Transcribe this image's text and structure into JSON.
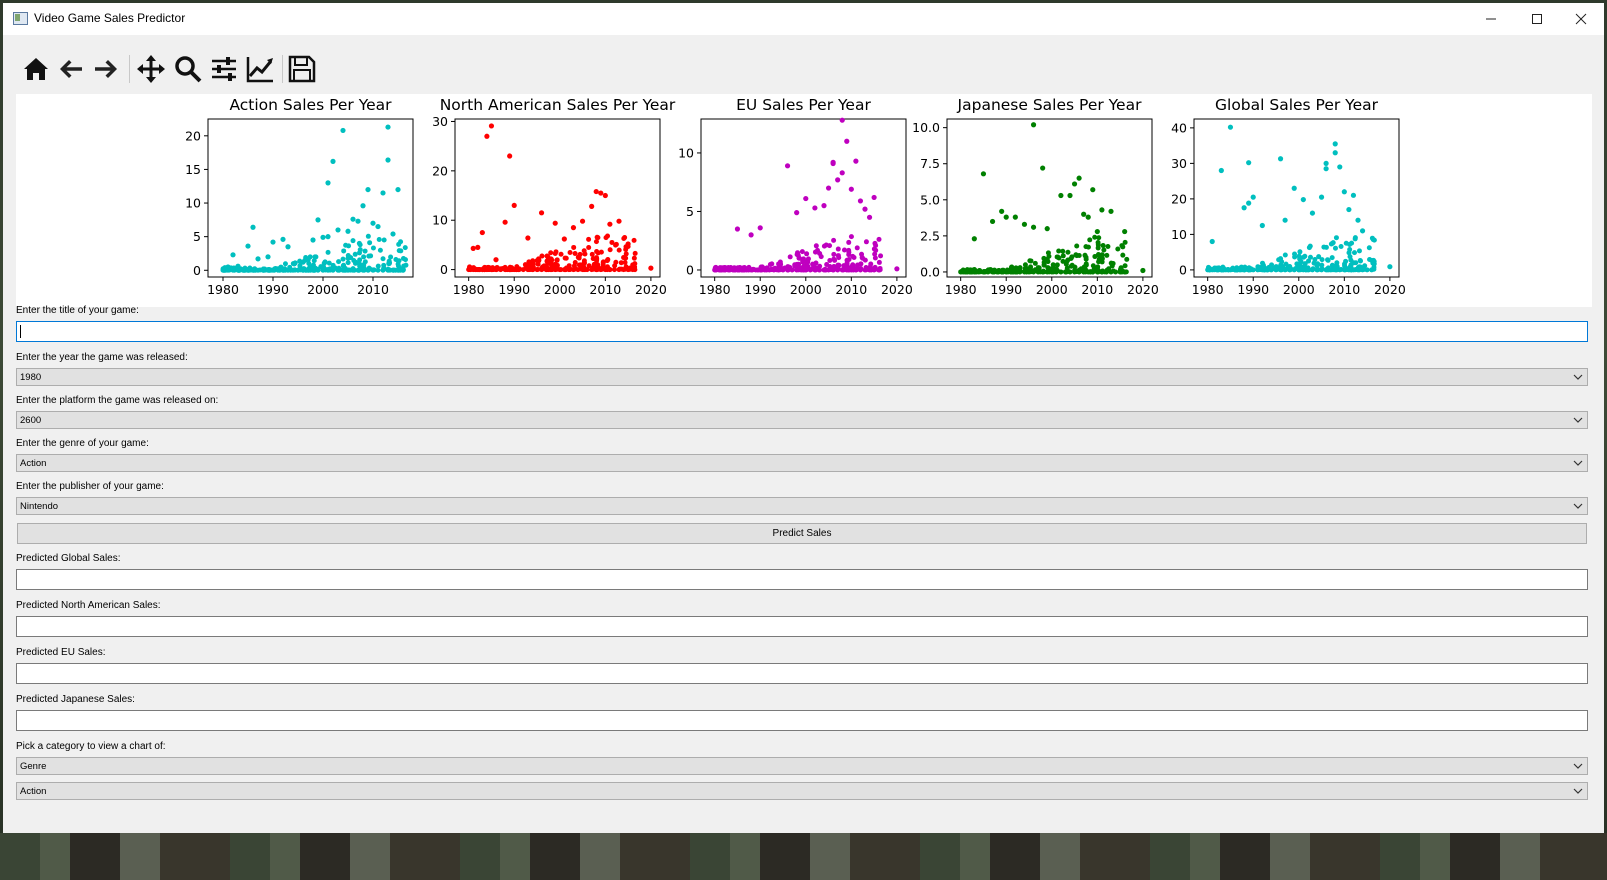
{
  "window": {
    "title": "Video Game Sales Predictor"
  },
  "toolbar": {
    "buttons": [
      "home-icon",
      "back-arrow-icon",
      "forward-arrow-icon",
      "pan-move-icon",
      "zoom-magnifier-icon",
      "configure-subplots-icon",
      "edit-axis-curve-icon",
      "save-floppy-icon"
    ]
  },
  "chart_data": [
    {
      "type": "scatter",
      "title": "Action Sales Per Year",
      "color": "#00bfbf",
      "xlim": [
        1977,
        2018
      ],
      "ylim": [
        -1,
        22.5
      ],
      "xticks": [
        "1980",
        "1990",
        "2000",
        "2010"
      ],
      "yticks": [
        "0",
        "5",
        "10",
        "15",
        "20"
      ],
      "x": [
        1981,
        1982,
        1983,
        1985,
        1986,
        1987,
        1989,
        1990,
        1992,
        1993,
        1996,
        1998,
        1999,
        2000,
        2001,
        2001,
        2002,
        2003,
        2004,
        2005,
        2006,
        2007,
        2008,
        2009,
        2010,
        2011,
        2012,
        2013,
        2013,
        2014,
        2015
      ],
      "y": [
        0.5,
        2.3,
        0.6,
        3.6,
        6.4,
        1.7,
        2.0,
        4.2,
        4.6,
        3.5,
        1.2,
        4.5,
        7.5,
        4.9,
        13.0,
        5.0,
        16.2,
        6.0,
        20.8,
        5.8,
        7.6,
        7.3,
        9.6,
        12.0,
        7.0,
        6.5,
        11.5,
        21.3,
        16.4,
        5.4,
        12.0
      ]
    },
    {
      "type": "scatter",
      "title": "North American Sales Per Year",
      "color": "#ff0000",
      "xlim": [
        1977,
        2022
      ],
      "ylim": [
        -1.5,
        30.5
      ],
      "xticks": [
        "1980",
        "1990",
        "2000",
        "2010",
        "2020"
      ],
      "yticks": [
        "0",
        "10",
        "20",
        "30"
      ],
      "x": [
        1981,
        1982,
        1983,
        1984,
        1985,
        1986,
        1988,
        1989,
        1990,
        1993,
        1996,
        1999,
        2001,
        2003,
        2005,
        2007,
        2008,
        2009,
        2010,
        2011,
        2013,
        2015,
        2020
      ],
      "y": [
        4.3,
        4.5,
        7.5,
        27.0,
        29.1,
        2.0,
        9.6,
        23.0,
        13.0,
        6.4,
        11.5,
        9.4,
        6.2,
        8.5,
        9.8,
        12.8,
        15.8,
        15.5,
        15.0,
        9.2,
        9.8,
        5.2,
        0.3
      ]
    },
    {
      "type": "scatter",
      "title": "EU Sales Per Year",
      "color": "#bf00bf",
      "xlim": [
        1977,
        2022
      ],
      "ylim": [
        -0.6,
        12.9
      ],
      "xticks": [
        "1980",
        "1990",
        "2000",
        "2010",
        "2020"
      ],
      "yticks": [
        "0",
        "5",
        "10"
      ],
      "x": [
        1983,
        1985,
        1988,
        1990,
        1996,
        1998,
        2000,
        2002,
        2004,
        2005,
        2006,
        2006,
        2007,
        2008,
        2008,
        2009,
        2010,
        2011,
        2012,
        2013,
        2014,
        2015,
        2020
      ],
      "y": [
        0.2,
        3.5,
        3.0,
        3.6,
        8.9,
        4.9,
        6.1,
        5.3,
        5.5,
        7.0,
        9.2,
        9.1,
        7.7,
        12.8,
        8.3,
        11.0,
        6.9,
        9.3,
        5.9,
        5.2,
        4.5,
        6.2,
        0.1
      ]
    },
    {
      "type": "scatter",
      "title": "Japanese Sales Per Year",
      "color": "#008000",
      "xlim": [
        1977,
        2022
      ],
      "ylim": [
        -0.35,
        10.6
      ],
      "xticks": [
        "1980",
        "1990",
        "2000",
        "2010",
        "2020"
      ],
      "yticks": [
        "0.0",
        "2.5",
        "5.0",
        "7.5",
        "10.0"
      ],
      "x": [
        1983,
        1985,
        1987,
        1989,
        1990,
        1992,
        1994,
        1996,
        1996,
        1998,
        1999,
        2002,
        2004,
        2005,
        2006,
        2007,
        2008,
        2009,
        2010,
        2011,
        2013,
        2016,
        2020
      ],
      "y": [
        2.3,
        6.8,
        3.5,
        4.2,
        3.8,
        3.8,
        3.3,
        10.2,
        3.1,
        7.2,
        3.0,
        5.3,
        5.3,
        6.1,
        6.5,
        4.0,
        3.8,
        5.7,
        2.8,
        4.3,
        4.2,
        2.8,
        0.1
      ]
    },
    {
      "type": "scatter",
      "title": "Global Sales Per Year",
      "color": "#00bfbf",
      "xlim": [
        1977,
        2022
      ],
      "ylim": [
        -2,
        42.5
      ],
      "xticks": [
        "1980",
        "1990",
        "2000",
        "2010",
        "2020"
      ],
      "yticks": [
        "0",
        "10",
        "20",
        "30",
        "40"
      ],
      "x": [
        1981,
        1983,
        1985,
        1988,
        1989,
        1989,
        1990,
        1992,
        1996,
        1997,
        1999,
        2001,
        2003,
        2005,
        2006,
        2006,
        2008,
        2008,
        2009,
        2010,
        2011,
        2012,
        2013,
        2014,
        2020
      ],
      "y": [
        8.0,
        28.0,
        40.2,
        17.5,
        30.2,
        18.8,
        20.5,
        12.5,
        31.3,
        14.0,
        23.0,
        19.8,
        16.0,
        20.5,
        30.0,
        28.5,
        35.5,
        33.0,
        29.0,
        22.0,
        17.0,
        21.0,
        14.0,
        11.0,
        0.9
      ]
    }
  ],
  "form": {
    "title_label": "Enter the title of your game:",
    "title_value": "",
    "year_label": "Enter the year the game was released:",
    "year_value": "1980",
    "platform_label": "Enter the platform the game was released on:",
    "platform_value": "2600",
    "genre_label": "Enter the genre of your game:",
    "genre_value": "Action",
    "publisher_label": "Enter the publisher of your game:",
    "publisher_value": "Nintendo",
    "predict_button": "Predict Sales",
    "global_label": "Predicted Global Sales:",
    "global_value": "",
    "na_label": "Predicted North American Sales:",
    "na_value": "",
    "eu_label": "Predicted EU Sales:",
    "eu_value": "",
    "jp_label": "Predicted Japanese Sales:",
    "jp_value": "",
    "category_label": "Pick a category to view a chart of:",
    "category_value": "Genre",
    "category_item_value": "Action"
  }
}
